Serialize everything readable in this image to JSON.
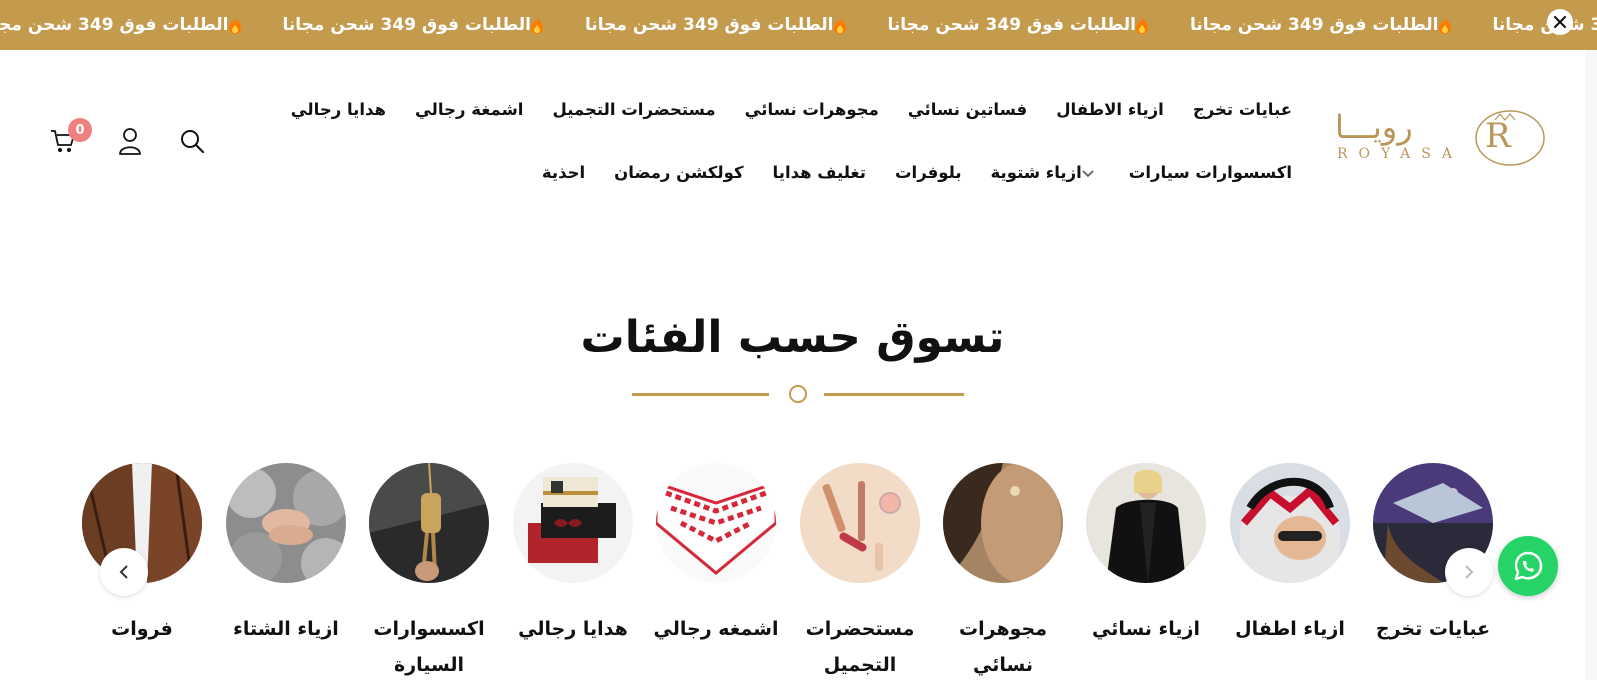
{
  "announcement": {
    "text": "الطلبات فوق 349 شحن مجانا",
    "repeat_count": 6,
    "icon": "flame-icon"
  },
  "brand": {
    "logo_arabic": "رويـــا",
    "logo_latin": "ROYASA",
    "logo_mark": "R"
  },
  "nav": {
    "row1": [
      "عبايات تخرج",
      "ازياء الاطفال",
      "فساتين نسائي",
      "مجوهرات نسائي",
      "مستحضرات التجميل",
      "اشمغة رجالي",
      "هدايا رجالي"
    ],
    "row2": [
      "اكسسوارات سيارات",
      "ازياء شتوية",
      "بلوفرات",
      "تغليف هدايا",
      "كولكشن رمضان",
      "احذية"
    ]
  },
  "header": {
    "cart_count": "0"
  },
  "section": {
    "title": "تسوق حسب الفئات"
  },
  "categories": [
    {
      "label": "عبايات تخرج"
    },
    {
      "label": "ازياء اطفال"
    },
    {
      "label": "ازياء نسائي"
    },
    {
      "label": "مجوهرات نسائي"
    },
    {
      "label": "مستحضرات التجميل"
    },
    {
      "label": "اشمغه رجالي"
    },
    {
      "label": "هدايا رجالي"
    },
    {
      "label": "اكسسوارات السيارة"
    },
    {
      "label": "ازياء الشتاء"
    },
    {
      "label": "فروات"
    }
  ],
  "colors": {
    "gold": "#c49a4d",
    "badge": "#f08080",
    "whatsapp": "#25d366"
  }
}
